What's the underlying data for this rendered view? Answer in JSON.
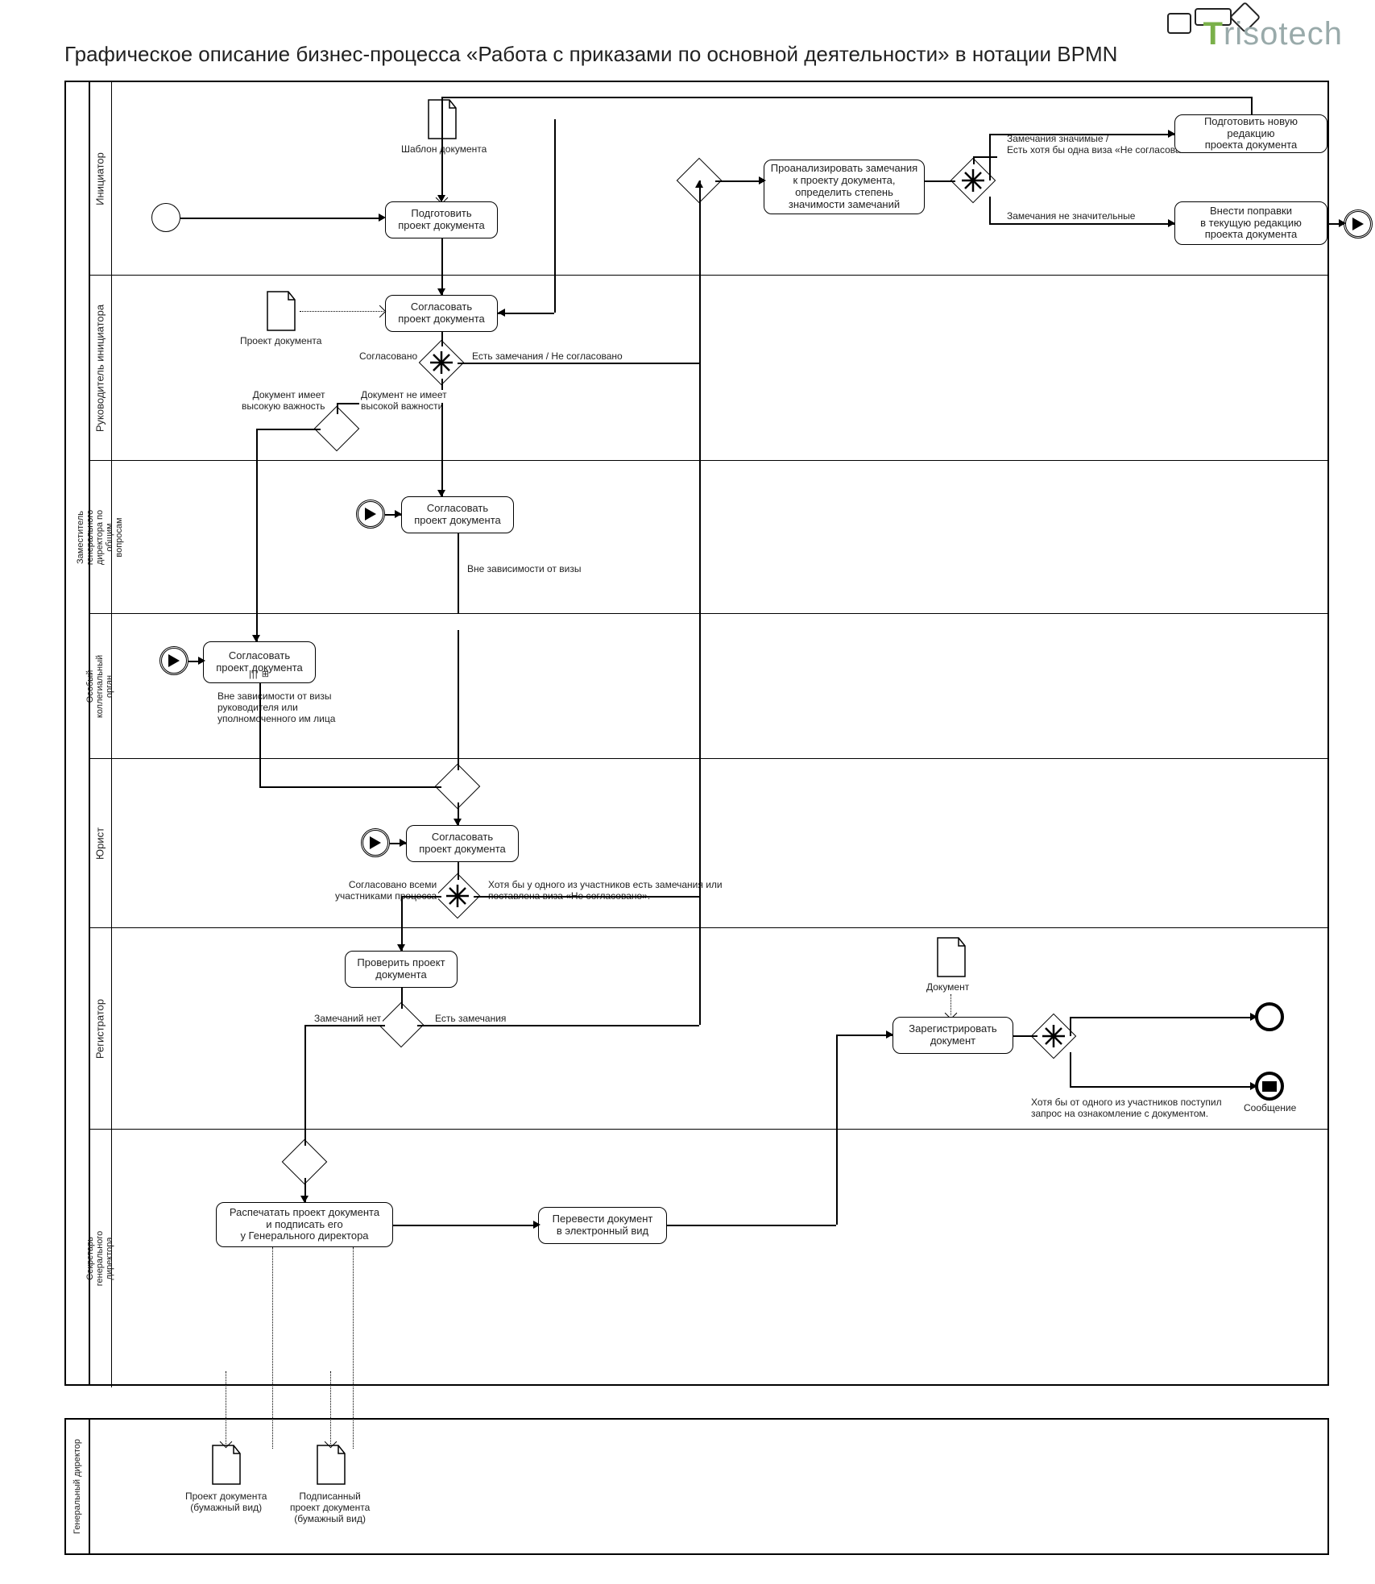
{
  "title": "Графическое описание бизнес-процесса «Работа с приказами по основной деятельности» в нотации BPMN",
  "logo": {
    "t": "T",
    "rest": "risotech"
  },
  "lanes": {
    "l1": "Инициатор",
    "l2": "Руководитель инициатора",
    "l3": "Заместитель генерального\nдиректора по общим вопросам",
    "l4": "Особый коллегиальный\nорган",
    "l5": "Юрист",
    "l6": "Регистратор",
    "l7": "Секретарь генерального\nдиректора"
  },
  "extra_lane": "Генеральный директор",
  "docs": {
    "template": "Шаблон документа",
    "draft": "Проект документа",
    "document": "Документ",
    "paper_draft": "Проект документа\n(бумажный вид)",
    "signed_paper": "Подписанный\nпроект документа\n(бумажный вид)"
  },
  "tasks": {
    "prepare": "Подготовить\nпроект документа",
    "approve_mgr": "Согласовать\nпроект документа",
    "approve_dep": "Согласовать\nпроект документа",
    "approve_col": "Согласовать\nпроект документа",
    "approve_law": "Согласовать\nпроект документа",
    "check": "Проверить проект\nдокумента",
    "analyze": "Проанализировать замечания\nк проекту документа,\nопределить степень\nзначимости замечаний",
    "new_rev": "Подготовить новую редакцию\nпроекта документа",
    "minor_fix": "Внести поправки\nв текущую редакцию\nпроекта документа",
    "register": "Зарегистрировать\nдокумент",
    "print_sign": "Распечатать проект документа\nи подписать его\nу Генерального директора",
    "to_electronic": "Перевести документ\nв электронный вид"
  },
  "conditions": {
    "agreed": "Согласовано",
    "has_remarks": "Есть замечания / Не согласовано",
    "high_imp": "Документ имеет\nвысокую важность",
    "low_imp": "Документ не имеет\nвысокой важности",
    "any_visa": "Вне зависимости от визы",
    "any_visa_long": "Вне зависимости от визы\nруководителя или\nуполномоченного им лица",
    "all_agreed": "Согласовано всеми\nучастниками процесса",
    "one_remark": "Хотя бы у одного из участников есть замечания или\nпоставлена виза «Не согласовано».",
    "no_remarks": "Замечаний нет",
    "has_remarks2": "Есть замечания",
    "significant": "Замечания значимые /\nЕсть хотя бы одна виза «Не согласовано»",
    "insignificant": "Замечания не значительные",
    "review_req": "Хотя бы от одного из участников поступил\nзапрос на ознакомление с документом.",
    "msg": "Сообщение"
  }
}
